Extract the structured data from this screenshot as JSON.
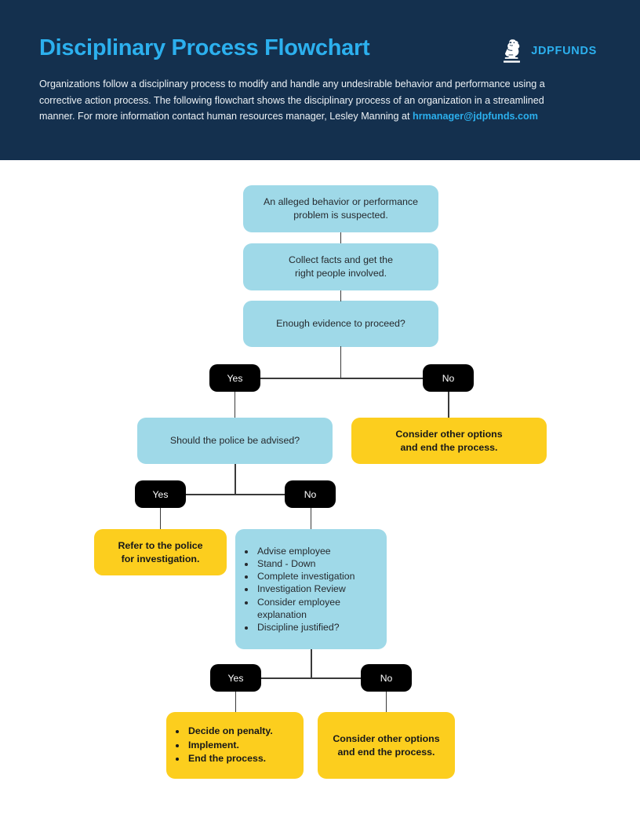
{
  "header": {
    "title": "Disciplinary Process Flowchart",
    "brand_name": "JDPFUNDS",
    "logo_icon": "lion-statue-icon",
    "intro_part1": "Organizations follow a disciplinary process to modify and handle any undesirable behavior and performance using a corrective action process. The following flowchart shows the disciplinary process of an organization in a streamlined manner. For more information contact human resources manager, Lesley Manning at ",
    "intro_email": "hrmanager@jdpfunds.com",
    "colors": {
      "background": "#14304e",
      "accent": "#2cb0ee",
      "body_text": "#edf2f6"
    }
  },
  "chart_data": {
    "type": "diagram",
    "title": "Disciplinary Process Flowchart",
    "colors": {
      "process": "#9fd9e8",
      "outcome": "#fcce1e",
      "decision": "#000000",
      "connector": "#3a3a3a"
    },
    "nodes": {
      "n1": {
        "label": "An alleged behavior or performance problem is suspected.",
        "kind": "process"
      },
      "n2": {
        "label": "Collect facts and get the\nright people involved.",
        "line1": "Collect facts and get the",
        "line2": "right people involved.",
        "kind": "process"
      },
      "n3": {
        "label": "Enough evidence to proceed?",
        "kind": "process"
      },
      "d1_yes": {
        "label": "Yes",
        "kind": "decision"
      },
      "d1_no": {
        "label": "No",
        "kind": "decision"
      },
      "n4": {
        "label": "Should the police be advised?",
        "kind": "process"
      },
      "n5": {
        "line1": "Consider other options",
        "line2": "and end the process.",
        "kind": "outcome"
      },
      "d2_yes": {
        "label": "Yes",
        "kind": "decision"
      },
      "d2_no": {
        "label": "No",
        "kind": "decision"
      },
      "n6": {
        "line1": "Refer to the police",
        "line2": "for investigation.",
        "kind": "outcome"
      },
      "n7": {
        "kind": "process",
        "items": [
          "Advise employee",
          "Stand - Down",
          "Complete investigation",
          "Investigation Review",
          "Consider employee explanation",
          "Discipline justified?"
        ]
      },
      "d3_yes": {
        "label": "Yes",
        "kind": "decision"
      },
      "d3_no": {
        "label": "No",
        "kind": "decision"
      },
      "n8": {
        "kind": "outcome",
        "items": [
          "Decide on penalty.",
          "Implement.",
          "End the process."
        ]
      },
      "n9": {
        "line1": "Consider other options",
        "line2": "and end the process.",
        "kind": "outcome"
      }
    },
    "edges": [
      {
        "from": "n1",
        "to": "n2"
      },
      {
        "from": "n2",
        "to": "n3"
      },
      {
        "from": "n3",
        "to": "d1_yes",
        "label": "Yes"
      },
      {
        "from": "n3",
        "to": "d1_no",
        "label": "No"
      },
      {
        "from": "d1_yes",
        "to": "n4"
      },
      {
        "from": "d1_no",
        "to": "n5"
      },
      {
        "from": "n4",
        "to": "d2_yes",
        "label": "Yes"
      },
      {
        "from": "n4",
        "to": "d2_no",
        "label": "No"
      },
      {
        "from": "d2_yes",
        "to": "n6"
      },
      {
        "from": "d2_no",
        "to": "n7"
      },
      {
        "from": "n7",
        "to": "d3_yes",
        "label": "Yes"
      },
      {
        "from": "n7",
        "to": "d3_no",
        "label": "No"
      },
      {
        "from": "d3_yes",
        "to": "n8"
      },
      {
        "from": "d3_no",
        "to": "n9"
      }
    ]
  }
}
